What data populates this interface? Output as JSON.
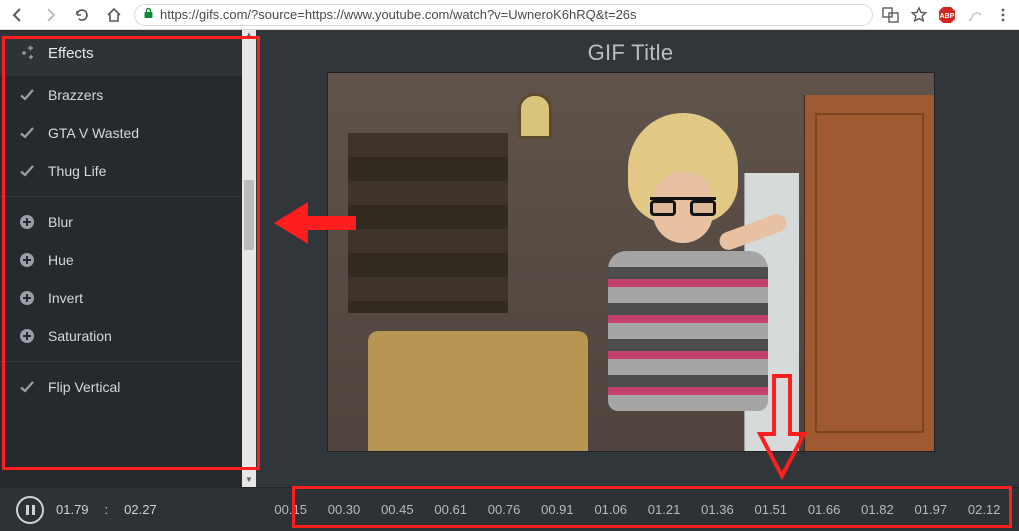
{
  "browser": {
    "url": "https://gifs.com/?source=https://www.youtube.com/watch?v=UwneroK6hRQ&t=26s",
    "abp_label": "ABP"
  },
  "sidebar": {
    "header": "Effects",
    "groups": [
      {
        "items": [
          {
            "icon": "check",
            "label": "Brazzers"
          },
          {
            "icon": "check",
            "label": "GTA V Wasted"
          },
          {
            "icon": "check",
            "label": "Thug Life"
          }
        ]
      },
      {
        "items": [
          {
            "icon": "plus",
            "label": "Blur"
          },
          {
            "icon": "plus",
            "label": "Hue"
          },
          {
            "icon": "plus",
            "label": "Invert"
          },
          {
            "icon": "plus",
            "label": "Saturation"
          }
        ]
      },
      {
        "items": [
          {
            "icon": "check",
            "label": "Flip Vertical"
          }
        ]
      }
    ]
  },
  "viewer": {
    "title": "GIF Title"
  },
  "timeline": {
    "current": "01.79",
    "sep": ":",
    "end": "02.27",
    "ticks": [
      "00.15",
      "00.30",
      "00.45",
      "00.61",
      "00.76",
      "00.91",
      "01.06",
      "01.21",
      "01.36",
      "01.51",
      "01.66",
      "01.82",
      "01.97",
      "02.12"
    ]
  }
}
